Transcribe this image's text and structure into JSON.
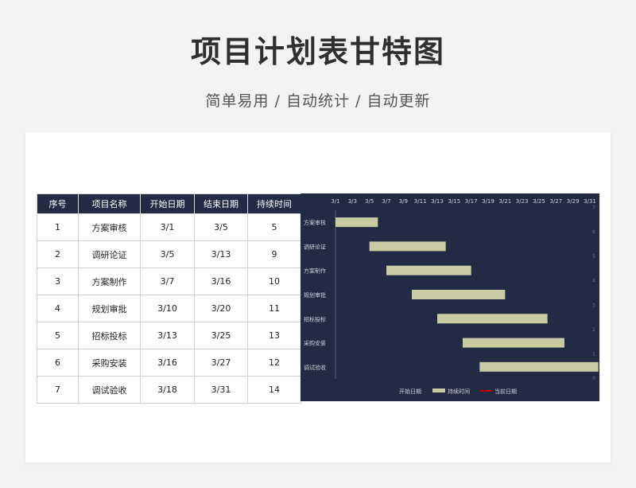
{
  "header": {
    "title": "项目计划表甘特图",
    "subtitle": "简单易用 / 自动统计 / 自动更新"
  },
  "table": {
    "columns": [
      "序号",
      "项目名称",
      "开始日期",
      "结束日期",
      "持续时间"
    ],
    "rows": [
      [
        "1",
        "方案审核",
        "3/1",
        "3/5",
        "5"
      ],
      [
        "2",
        "调研论证",
        "3/5",
        "3/13",
        "9"
      ],
      [
        "3",
        "方案制作",
        "3/7",
        "3/16",
        "10"
      ],
      [
        "4",
        "规划审批",
        "3/10",
        "3/20",
        "11"
      ],
      [
        "5",
        "招标投标",
        "3/13",
        "3/25",
        "13"
      ],
      [
        "6",
        "采购安装",
        "3/16",
        "3/27",
        "12"
      ],
      [
        "7",
        "调试验收",
        "3/18",
        "3/31",
        "14"
      ]
    ]
  },
  "colors": {
    "header_bg": "#222a44",
    "chart_bg": "#222a44",
    "bar": "#c9cba3",
    "current_date": "#c00000",
    "text_light": "#cfd3dc"
  },
  "chart_data": {
    "type": "bar",
    "orientation": "horizontal-stacked-gantt",
    "categories": [
      "方案审核",
      "调研论证",
      "方案制作",
      "规划审批",
      "招标投标",
      "采购安装",
      "调试验收"
    ],
    "x_tick_labels": [
      "3/1",
      "3/3",
      "3/5",
      "3/7",
      "3/9",
      "3/11",
      "3/13",
      "3/15",
      "3/17",
      "3/19",
      "3/21",
      "3/23",
      "3/25",
      "3/27",
      "3/29",
      "3/31"
    ],
    "x_range_days": [
      1,
      31
    ],
    "secondary_y_ticks": [
      "7",
      "6",
      "5",
      "4",
      "3",
      "2",
      "1",
      "0"
    ],
    "series": [
      {
        "name": "开始日期",
        "values": [
          1,
          5,
          7,
          10,
          13,
          16,
          18
        ],
        "visible": false
      },
      {
        "name": "持续时间",
        "values": [
          5,
          9,
          10,
          11,
          13,
          12,
          14
        ],
        "visible": true
      },
      {
        "name": "当前日期",
        "values": [],
        "visible": true
      }
    ],
    "legend_position": "bottom",
    "grid": false
  }
}
